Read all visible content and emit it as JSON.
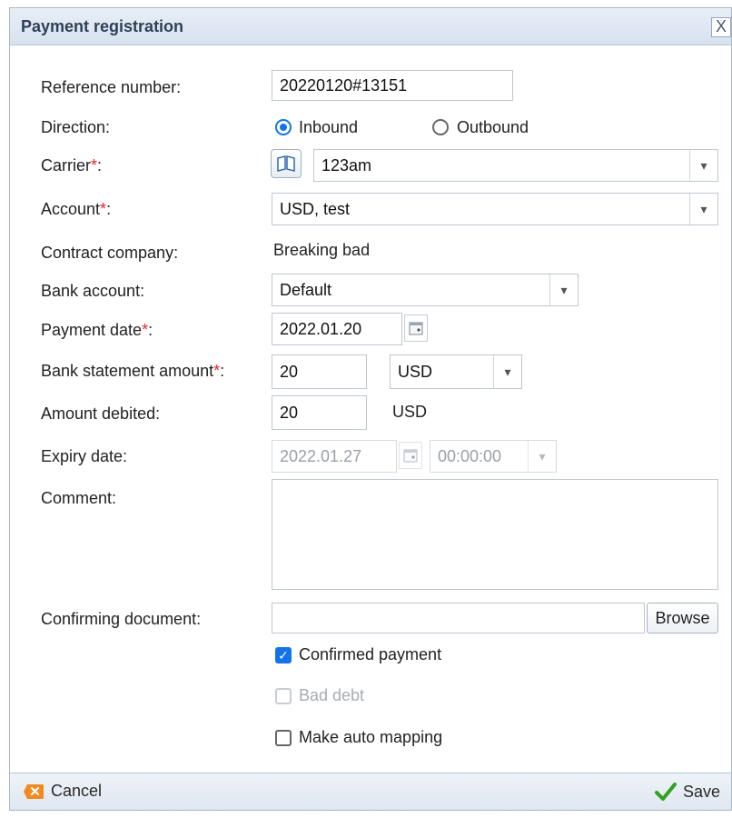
{
  "dialog": {
    "title": "Payment registration",
    "close_glyph": "X"
  },
  "form": {
    "reference_label": "Reference number:",
    "reference_value": "20220120#13151",
    "direction_label": "Direction:",
    "direction_inbound": "Inbound",
    "direction_outbound": "Outbound",
    "carrier_label": "Carrier",
    "carrier_value": "123am",
    "account_label": "Account",
    "account_value": "USD, test",
    "contract_label": "Contract company:",
    "contract_value": "Breaking bad",
    "bank_account_label": "Bank account:",
    "bank_account_value": "Default",
    "payment_date_label": "Payment date",
    "payment_date_value": "2022.01.20",
    "statement_amount_label": "Bank statement amount",
    "statement_amount_value": "20",
    "statement_currency_value": "USD",
    "debited_label": "Amount debited:",
    "debited_value": "20",
    "debited_currency": "USD",
    "expiry_label": "Expiry date:",
    "expiry_date_value": "2022.01.27",
    "expiry_time_value": "00:00:00",
    "comment_label": "Comment:",
    "confirming_doc_label": "Confirming document:",
    "browse_label": "Browse",
    "confirmed_payment_label": "Confirmed payment",
    "bad_debt_label": "Bad debt",
    "auto_mapping_label": "Make auto mapping"
  },
  "footer": {
    "cancel_label": "Cancel",
    "save_label": "Save"
  },
  "marks": {
    "required": "*",
    "colon": ":"
  },
  "colors": {
    "accent": "#1473e6",
    "required": "#e3262d",
    "save_check": "#33a11f",
    "cancel_badge": "#f28a20"
  }
}
